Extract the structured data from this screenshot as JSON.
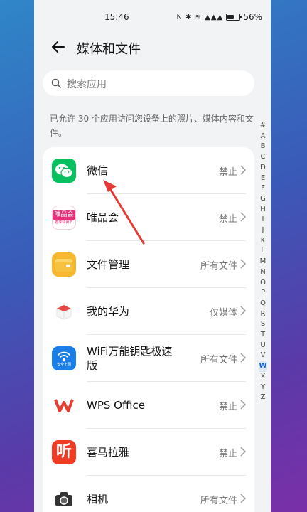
{
  "status_bar": {
    "time": "15:46",
    "icons": "N ✱ ≋ ▲▲▲",
    "battery": "56%",
    "battery_level": 0.56
  },
  "header": {
    "title": "媒体和文件"
  },
  "search": {
    "placeholder": "搜索应用"
  },
  "description": "已允许 30 个应用访问您设备上的照片、媒体内容和文件。",
  "apps": [
    {
      "name": "微信",
      "permission": "禁止",
      "icon": "wechat-icon"
    },
    {
      "name": "唯品会",
      "permission": "禁止",
      "icon": "vipshop-icon",
      "icon_text": "唯品会",
      "icon_subtext": "春季特卖节"
    },
    {
      "name": "文件管理",
      "permission": "所有文件",
      "icon": "file-manager-icon"
    },
    {
      "name": "我的华为",
      "permission": "仅媒体",
      "icon": "my-huawei-icon"
    },
    {
      "name_line1": "WiFi万能钥匙极速",
      "name_line2": "版",
      "permission": "所有文件",
      "icon": "wifi-key-icon",
      "icon_subtext": "安全上网"
    },
    {
      "name": "WPS Office",
      "permission": "禁止",
      "icon": "wps-icon"
    },
    {
      "name": "喜马拉雅",
      "permission": "禁止",
      "icon": "ximalaya-icon",
      "icon_text": "听"
    },
    {
      "name": "相机",
      "permission": "所有文件",
      "icon": "camera-icon"
    }
  ],
  "alphabet_index": [
    "#",
    "A",
    "B",
    "C",
    "D",
    "E",
    "F",
    "G",
    "H",
    "I",
    "J",
    "K",
    "L",
    "M",
    "N",
    "O",
    "P",
    "Q",
    "R",
    "S",
    "T",
    "U",
    "V",
    "W",
    "X",
    "Y",
    "Z"
  ],
  "alphabet_active": "W",
  "colors": {
    "wechat": "#07c160",
    "vipshop": "#e6327a",
    "files": "#f5b82e",
    "wifi": "#1a7ee8",
    "wps": "#e63b2e",
    "ximalaya": "#f03c24",
    "arrow": "#e53935"
  }
}
